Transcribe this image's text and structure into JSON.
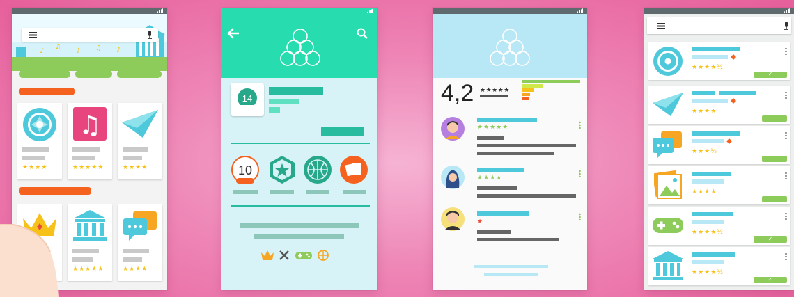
{
  "screen3": {
    "rating_value": "4,2",
    "rating_stars": "★★★★★"
  },
  "screen2": {
    "badge_number": "10",
    "app_icon_number": "14"
  },
  "ratings": {
    "s1_a": "★★★★",
    "s1_b": "★★★★★",
    "s1_c": "★★★★",
    "s1_d": "★★★★★",
    "s1_e": "★★★★",
    "reviews": [
      "★★★★★",
      "★★★★",
      "★"
    ],
    "list": [
      "★★★★½",
      "★★★★",
      "★★★½",
      "★★★★",
      "★★★★½",
      "★★★★½"
    ]
  },
  "colors": {
    "teal": "#27dcae",
    "cyan": "#4ec9dc",
    "green": "#8dcb5b",
    "orange": "#f5621f",
    "star": "#f6c21a",
    "status_bar": "#5e6a6d"
  },
  "icons": [
    "menu-icon",
    "microphone-icon",
    "back-arrow-icon",
    "search-icon",
    "camera-shutter-icon",
    "music-note-icon",
    "paper-plane-icon",
    "crown-icon",
    "bank-icon",
    "chat-bubbles-icon",
    "game-controller-icon",
    "picture-icon",
    "basketball-icon",
    "photo-cards-icon",
    "star-badge-icon",
    "swords-icon"
  ]
}
